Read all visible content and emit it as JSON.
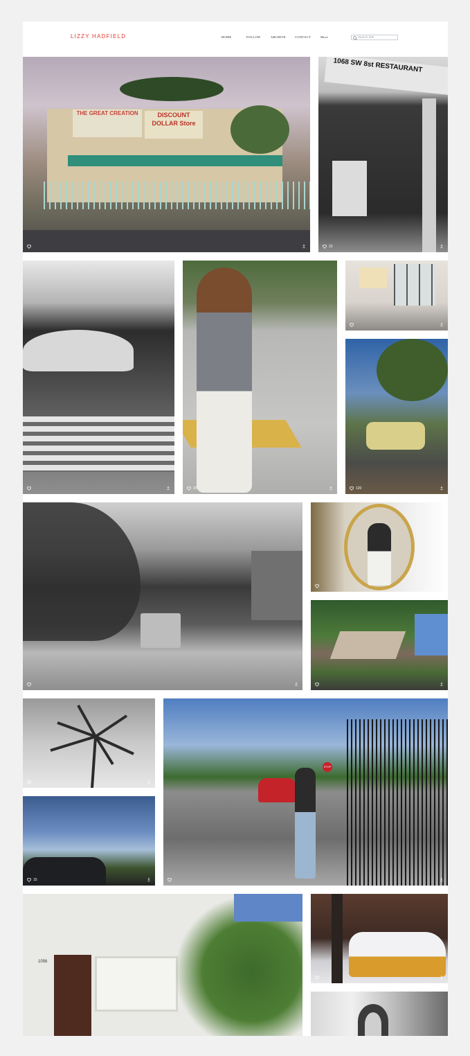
{
  "site": {
    "title": "LIZZY HADFIELD",
    "nav": [
      "HOME",
      "FOLLOW",
      "ARCHIVE",
      "CONTACT",
      "More"
    ],
    "search_placeholder": "Search Site"
  },
  "photos": [
    {
      "name": "photo-discount-dollar-store",
      "likes": "",
      "signs": [
        "THE GREAT CREATION",
        "DISCOUNT DOLLAR Store"
      ]
    },
    {
      "name": "photo-restaurant-entrance",
      "likes": "23",
      "signs": [
        "1068 SW 8st RESTAURANT"
      ]
    },
    {
      "name": "photo-beach-umbrella-loungers",
      "likes": "",
      "signs": []
    },
    {
      "name": "photo-woman-crosswalk",
      "likes": "29",
      "signs": []
    },
    {
      "name": "photo-shop-window",
      "likes": "",
      "signs": []
    },
    {
      "name": "photo-yellow-vintage-car",
      "likes": "120",
      "signs": []
    },
    {
      "name": "photo-palm-street-truck",
      "likes": "",
      "signs": []
    },
    {
      "name": "photo-mirror-selfie",
      "likes": "",
      "signs": []
    },
    {
      "name": "photo-house-trees",
      "likes": "",
      "signs": []
    },
    {
      "name": "photo-palm-sky-bw",
      "likes": "",
      "signs": []
    },
    {
      "name": "photo-sky-trees",
      "likes": "15",
      "signs": []
    },
    {
      "name": "photo-woman-sidewalk-red-car",
      "likes": "",
      "signs": [
        "STOP"
      ]
    },
    {
      "name": "photo-white-house-1056",
      "likes": "",
      "signs": [
        "1056"
      ]
    },
    {
      "name": "photo-snow-taxi",
      "likes": "",
      "signs": []
    },
    {
      "name": "photo-portrait-partial",
      "likes": "",
      "signs": []
    }
  ]
}
